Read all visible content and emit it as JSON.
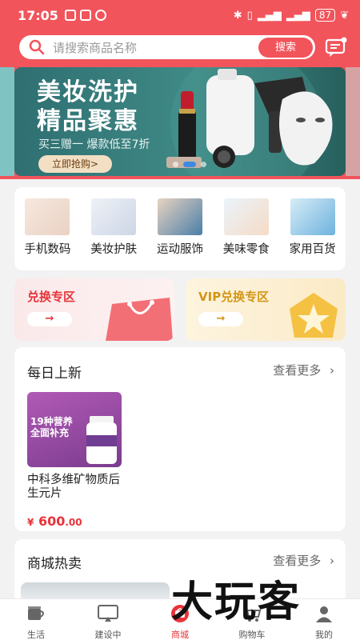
{
  "status_bar": {
    "time": "17:05",
    "battery": "87"
  },
  "search": {
    "placeholder": "请搜索商品名称",
    "button_label": "搜索"
  },
  "banner": {
    "title_line1": "美妆洗护",
    "title_line2": "精品聚惠",
    "subtitle": "买三赠一 爆款低至7折",
    "cta_label": "立即抢购>"
  },
  "categories": [
    {
      "label": "手机数码"
    },
    {
      "label": "美妆护肤"
    },
    {
      "label": "运动服饰"
    },
    {
      "label": "美味零食"
    },
    {
      "label": "家用百货"
    }
  ],
  "zones": {
    "exchange": {
      "title": "兑换专区",
      "arrow": "→"
    },
    "vip": {
      "title": "VIP兑换专区",
      "arrow": "→"
    }
  },
  "daily_new": {
    "title": "每日上新",
    "more_label": "查看更多",
    "product": {
      "name": "中科多维矿物质后生元片",
      "price_symbol": "¥",
      "price_int": "600",
      "price_cents": ".00",
      "image_text_line1": "19种营养",
      "image_text_line2": "全面补充"
    }
  },
  "hot_sale": {
    "title": "商城热卖",
    "more_label": "查看更多"
  },
  "bottom_nav": [
    {
      "label": "生活"
    },
    {
      "label": "建设中"
    },
    {
      "label": "商城"
    },
    {
      "label": "购物车"
    },
    {
      "label": "我的"
    }
  ],
  "watermark": "大玩客",
  "colors": {
    "accent": "#f2545c",
    "price": "#e8333a",
    "banner_bg": "#2f6f72"
  }
}
